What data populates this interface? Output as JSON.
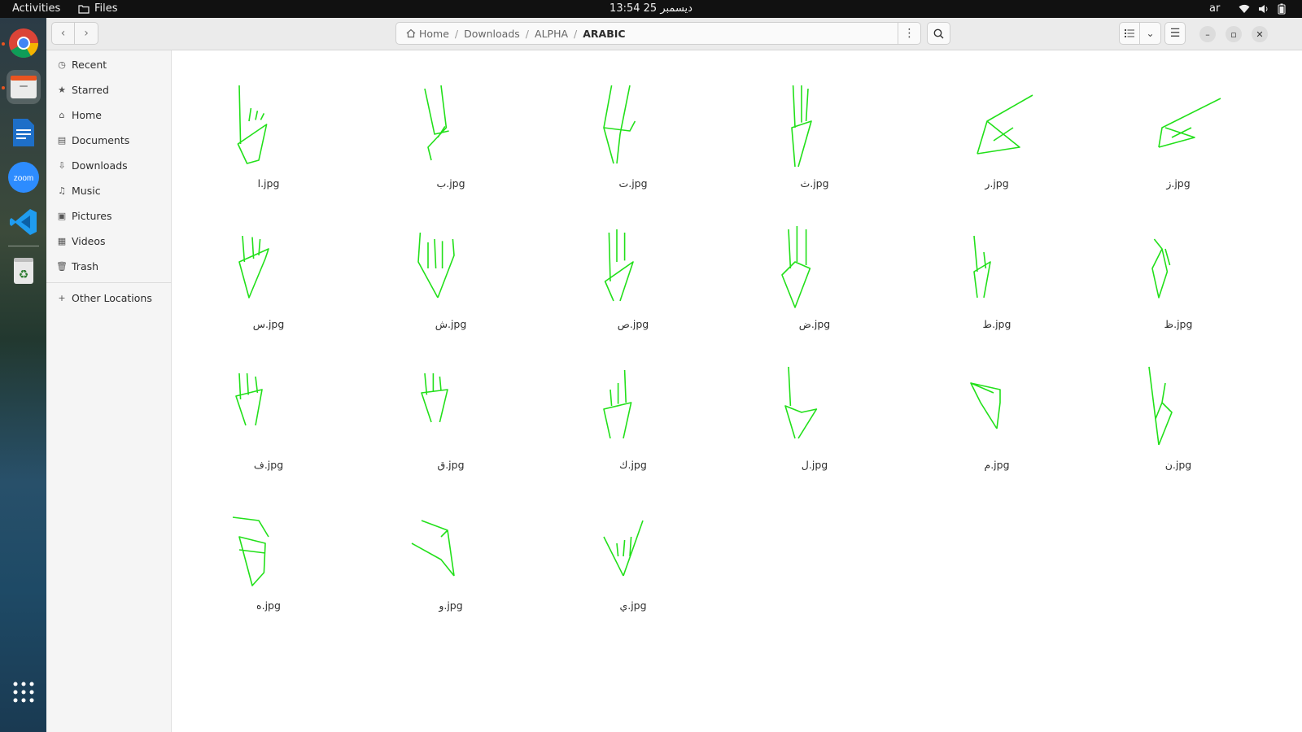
{
  "topbar": {
    "activities": "Activities",
    "app_name": "Files",
    "clock": "13:54  25 ديسمبر",
    "language": "ar"
  },
  "window": {
    "nav": {
      "back_icon": "chevron-left-icon",
      "forward_icon": "chevron-right-icon"
    },
    "path": {
      "home": "Home",
      "crumbs": [
        "Downloads",
        "ALPHA",
        "ARABIC"
      ]
    }
  },
  "sidebar": {
    "items": [
      {
        "label": "Recent",
        "icon": "clock-icon"
      },
      {
        "label": "Starred",
        "icon": "star-icon"
      },
      {
        "label": "Home",
        "icon": "home-icon"
      },
      {
        "label": "Documents",
        "icon": "document-icon"
      },
      {
        "label": "Downloads",
        "icon": "download-icon"
      },
      {
        "label": "Music",
        "icon": "music-icon"
      },
      {
        "label": "Pictures",
        "icon": "picture-icon"
      },
      {
        "label": "Videos",
        "icon": "video-icon"
      },
      {
        "label": "Trash",
        "icon": "trash-icon"
      }
    ],
    "other_locations": "Other Locations"
  },
  "files": [
    "ا.jpg",
    "ب.jpg",
    "ت.jpg",
    "ث.jpg",
    "ر.jpg",
    "ز.jpg",
    "س.jpg",
    "ش.jpg",
    "ص.jpg",
    "ض.jpg",
    "ط.jpg",
    "ظ.jpg",
    "ف.jpg",
    "ق.jpg",
    "ك.jpg",
    "ل.jpg",
    "م.jpg",
    "ن.jpg",
    "ه.jpg",
    "و.jpg",
    "ي.jpg"
  ],
  "colors": {
    "accent": "#e95420",
    "sketch": "#22e01a"
  }
}
